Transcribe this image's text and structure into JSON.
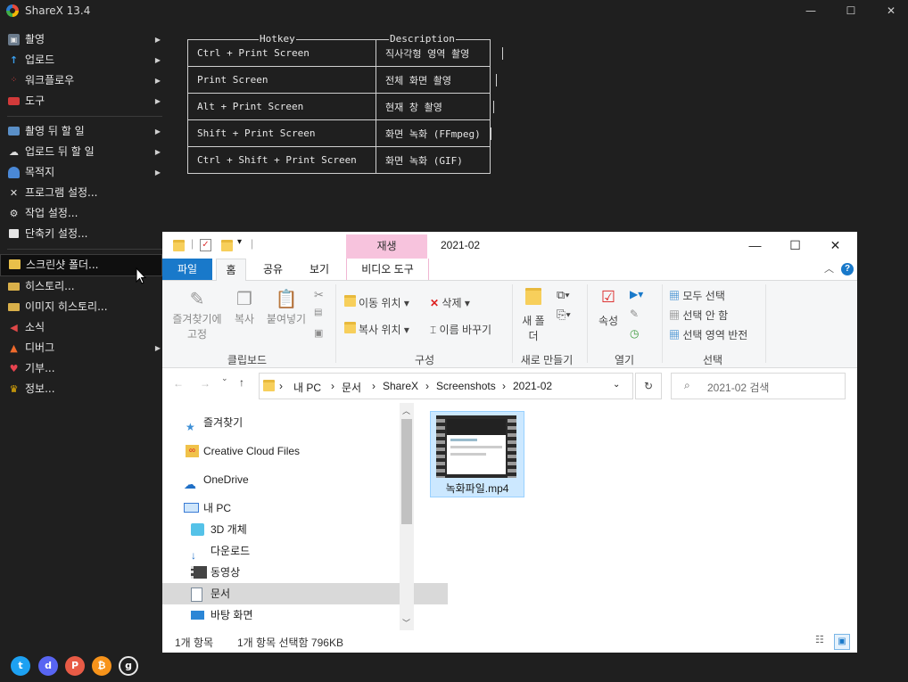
{
  "app": {
    "title": "ShareX 13.4",
    "window_buttons": [
      "—",
      "☐",
      "✕"
    ]
  },
  "menu": {
    "items1": [
      {
        "label": "촬영",
        "icon": "camera-icon"
      },
      {
        "label": "업로드",
        "icon": "upload-arrow-icon"
      },
      {
        "label": "워크플로우",
        "icon": "workflow-dots-icon"
      },
      {
        "label": "도구",
        "icon": "toolbox-icon"
      }
    ],
    "items2": [
      {
        "label": "촬영 뒤 할 일",
        "icon": "capture-after-icon"
      },
      {
        "label": "업로드 뒤 할 일",
        "icon": "cloud-upload-icon"
      },
      {
        "label": "목적지",
        "icon": "destination-icon"
      },
      {
        "label": "프로그램 설정...",
        "icon": "wrench-icon"
      },
      {
        "label": "작업 설정...",
        "icon": "gear-icon"
      },
      {
        "label": "단축키 설정...",
        "icon": "keyboard-icon"
      }
    ],
    "items3": [
      {
        "label": "스크린샷 폴더...",
        "icon": "screenshot-folder-icon"
      },
      {
        "label": "히스토리...",
        "icon": "history-icon"
      },
      {
        "label": "이미지 히스토리...",
        "icon": "image-history-icon"
      },
      {
        "label": "소식",
        "icon": "megaphone-icon"
      },
      {
        "label": "디버그",
        "icon": "debug-cone-icon"
      },
      {
        "label": "기부...",
        "icon": "heart-icon"
      },
      {
        "label": "정보...",
        "icon": "crown-icon"
      }
    ]
  },
  "social": [
    {
      "name": "twitter-icon",
      "glyph": "t",
      "color": "#1da1f2"
    },
    {
      "name": "discord-icon",
      "glyph": "d",
      "color": "#5865f2"
    },
    {
      "name": "patreon-icon",
      "glyph": "P",
      "color": "#e85b46"
    },
    {
      "name": "bitcoin-icon",
      "glyph": "₿",
      "color": "#f7931a"
    },
    {
      "name": "github-icon",
      "glyph": "g",
      "color": "#1f1f1f"
    }
  ],
  "hotkeys": {
    "header_key": "Hotkey",
    "header_desc": "Description",
    "rows": [
      {
        "key": "Ctrl + Print Screen",
        "desc": "직사각형 영역 촬영"
      },
      {
        "key": "Print Screen",
        "desc": "전체 화면 촬영"
      },
      {
        "key": "Alt + Print Screen",
        "desc": "현재 창 촬영"
      },
      {
        "key": "Shift + Print Screen",
        "desc": "화면 녹화 (FFmpeg)"
      },
      {
        "key": "Ctrl + Shift + Print Screen",
        "desc": "화면 녹화 (GIF)"
      }
    ]
  },
  "explorer": {
    "title": "2021-02",
    "context_tab": "재생",
    "tabs": [
      "파일",
      "홈",
      "공유",
      "보기",
      "비디오 도구"
    ],
    "ribbon": {
      "pin": "즐겨찾기에 고정",
      "copy": "복사",
      "paste": "붙여넣기",
      "move_to": "이동 위치",
      "delete": "삭제",
      "copy_to": "복사 위치",
      "rename": "이름 바꾸기",
      "new_folder": "새 폴더",
      "properties": "속성",
      "select_all": "모두 선택",
      "select_none": "선택 안 함",
      "invert_selection": "선택 영역 반전",
      "group_clipboard": "클립보드",
      "group_organize": "구성",
      "group_new": "새로 만들기",
      "group_open": "열기",
      "group_select": "선택"
    },
    "breadcrumbs": [
      "내 PC",
      "문서",
      "ShareX",
      "Screenshots",
      "2021-02"
    ],
    "search_placeholder": "2021-02 검색",
    "nav": [
      {
        "label": "즐겨찾기",
        "icon": "star-icon"
      },
      {
        "label": "Creative Cloud Files",
        "icon": "creative-cloud-icon"
      },
      {
        "label": "OneDrive",
        "icon": "onedrive-icon"
      },
      {
        "label": "내 PC",
        "icon": "pc-icon"
      },
      {
        "label": "3D 개체",
        "icon": "cube-icon"
      },
      {
        "label": "다운로드",
        "icon": "download-icon"
      },
      {
        "label": "동영상",
        "icon": "video-icon"
      },
      {
        "label": "문서",
        "icon": "document-icon"
      },
      {
        "label": "바탕 화면",
        "icon": "desktop-icon"
      }
    ],
    "file": {
      "name": "녹화파일.mp4"
    },
    "status_count": "1개 항목",
    "status_selected": "1개 항목 선택함 796KB"
  }
}
